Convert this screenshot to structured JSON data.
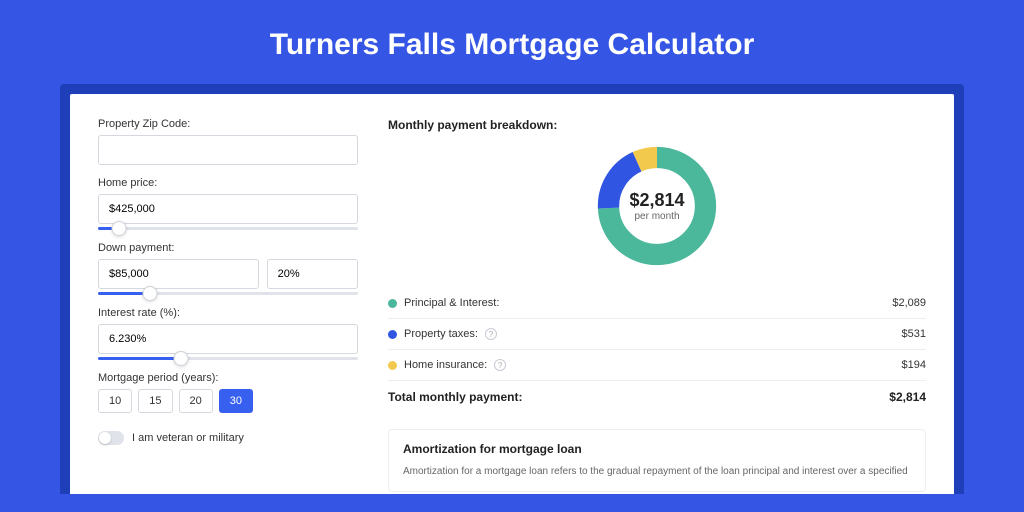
{
  "title": "Turners Falls Mortgage Calculator",
  "left": {
    "zip_label": "Property Zip Code:",
    "zip_value": "",
    "home_price_label": "Home price:",
    "home_price_value": "$425,000",
    "down_payment_label": "Down payment:",
    "down_payment_value": "$85,000",
    "down_payment_pct": "20%",
    "interest_label": "Interest rate (%):",
    "interest_value": "6.230%",
    "period_label": "Mortgage period (years):",
    "periods": [
      "10",
      "15",
      "20",
      "30"
    ],
    "period_active": "30",
    "veteran_label": "I am veteran or military"
  },
  "right": {
    "breakdown_title": "Monthly payment breakdown:",
    "center_value": "$2,814",
    "center_sub": "per month",
    "items": [
      {
        "color": "#4bb79b",
        "label": "Principal & Interest:",
        "info": false,
        "value": "$2,089"
      },
      {
        "color": "#2f55e2",
        "label": "Property taxes:",
        "info": true,
        "value": "$531"
      },
      {
        "color": "#f2c94c",
        "label": "Home insurance:",
        "info": true,
        "value": "$194"
      }
    ],
    "total_label": "Total monthly payment:",
    "total_value": "$2,814",
    "amort_title": "Amortization for mortgage loan",
    "amort_text": "Amortization for a mortgage loan refers to the gradual repayment of the loan principal and interest over a specified"
  },
  "chart_data": {
    "type": "pie",
    "title": "Monthly payment breakdown",
    "series": [
      {
        "name": "Principal & Interest",
        "value": 2089,
        "color": "#4bb79b"
      },
      {
        "name": "Property taxes",
        "value": 531,
        "color": "#2f55e2"
      },
      {
        "name": "Home insurance",
        "value": 194,
        "color": "#f2c94c"
      }
    ],
    "total": 2814
  }
}
